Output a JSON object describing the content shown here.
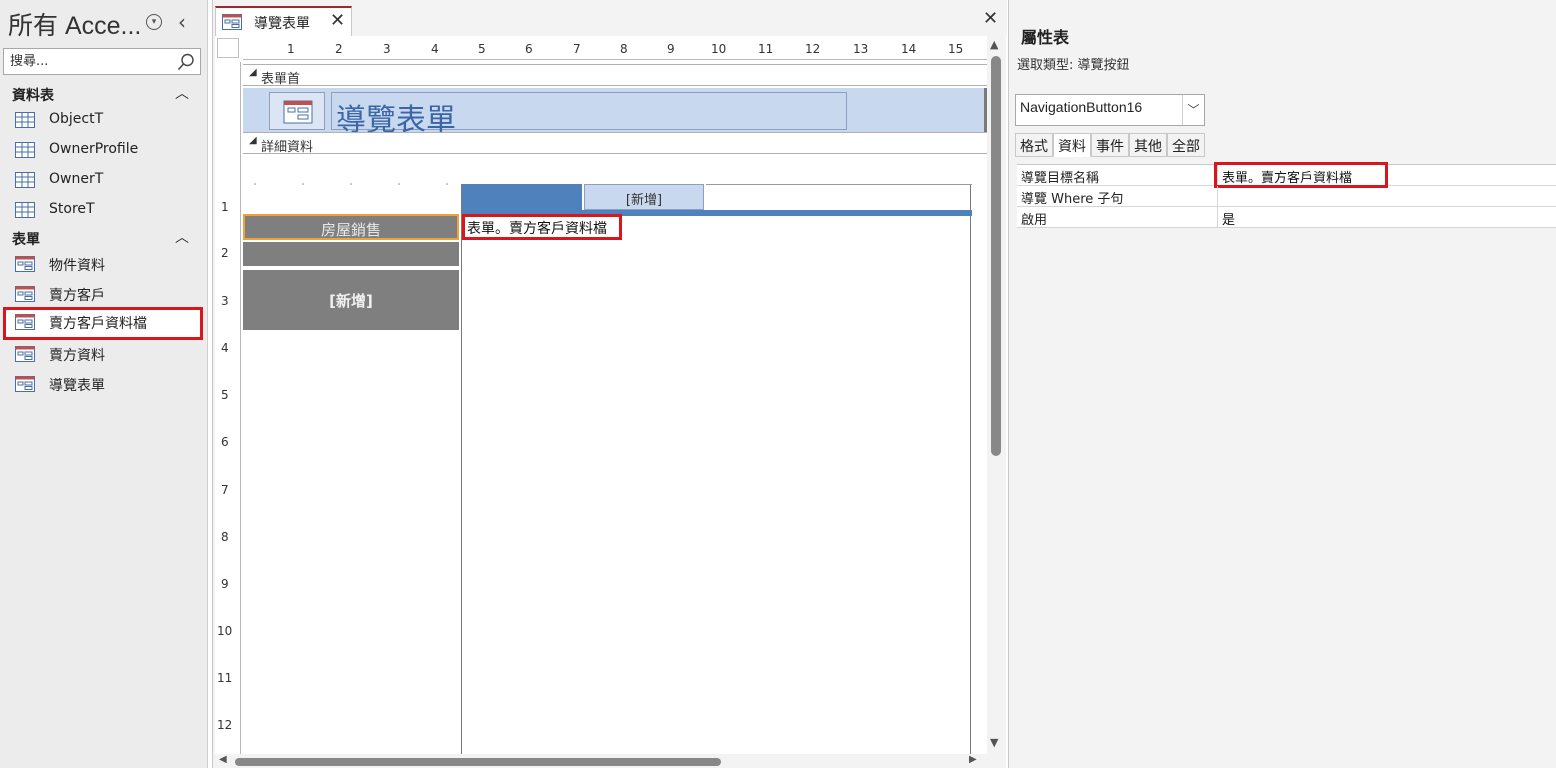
{
  "nav": {
    "title": "所有 Acce...",
    "search_placeholder": "搜尋...",
    "groups": [
      {
        "label": "資料表",
        "items": [
          "ObjectT",
          "OwnerProfile",
          "OwnerT",
          "StoreT"
        ]
      },
      {
        "label": "表單",
        "items": [
          "物件資料",
          "賣方客戶",
          "賣方客戶資料檔",
          "賣方資料",
          "導覽表單"
        ]
      }
    ],
    "highlighted_item": "賣方客戶資料檔"
  },
  "document": {
    "tab_label": "導覽表單",
    "ruler_h": [
      "1",
      "2",
      "3",
      "4",
      "5",
      "6",
      "7",
      "8",
      "9",
      "10",
      "11",
      "12",
      "13",
      "14",
      "15"
    ],
    "ruler_v": [
      "1",
      "2",
      "3",
      "4",
      "5",
      "6",
      "7",
      "8",
      "9",
      "10",
      "11",
      "12"
    ],
    "form_header_label": "表單首",
    "form_title": "導覽表單",
    "detail_label": "詳細資料",
    "nav_buttons": [
      "房屋銷售",
      "",
      "[新增]"
    ],
    "subform_tab_add": "[新增]",
    "subform_target": "表單。賣方客戶資料檔"
  },
  "properties": {
    "title": "屬性表",
    "selection_type": "選取類型: 導覽按鈕",
    "object_name": "NavigationButton16",
    "tabs": [
      "格式",
      "資料",
      "事件",
      "其他",
      "全部"
    ],
    "active_tab": "資料",
    "rows": [
      {
        "key": "導覽目標名稱",
        "value": "表單。賣方客戶資料檔"
      },
      {
        "key": "導覽 Where 子句",
        "value": ""
      },
      {
        "key": "啟用",
        "value": "是"
      }
    ]
  },
  "colors": {
    "accent_red": "#d9161c",
    "header_band": "#c8d8ee",
    "nav_button": "#7f7f7f",
    "tab_blue": "#4f81bd"
  }
}
